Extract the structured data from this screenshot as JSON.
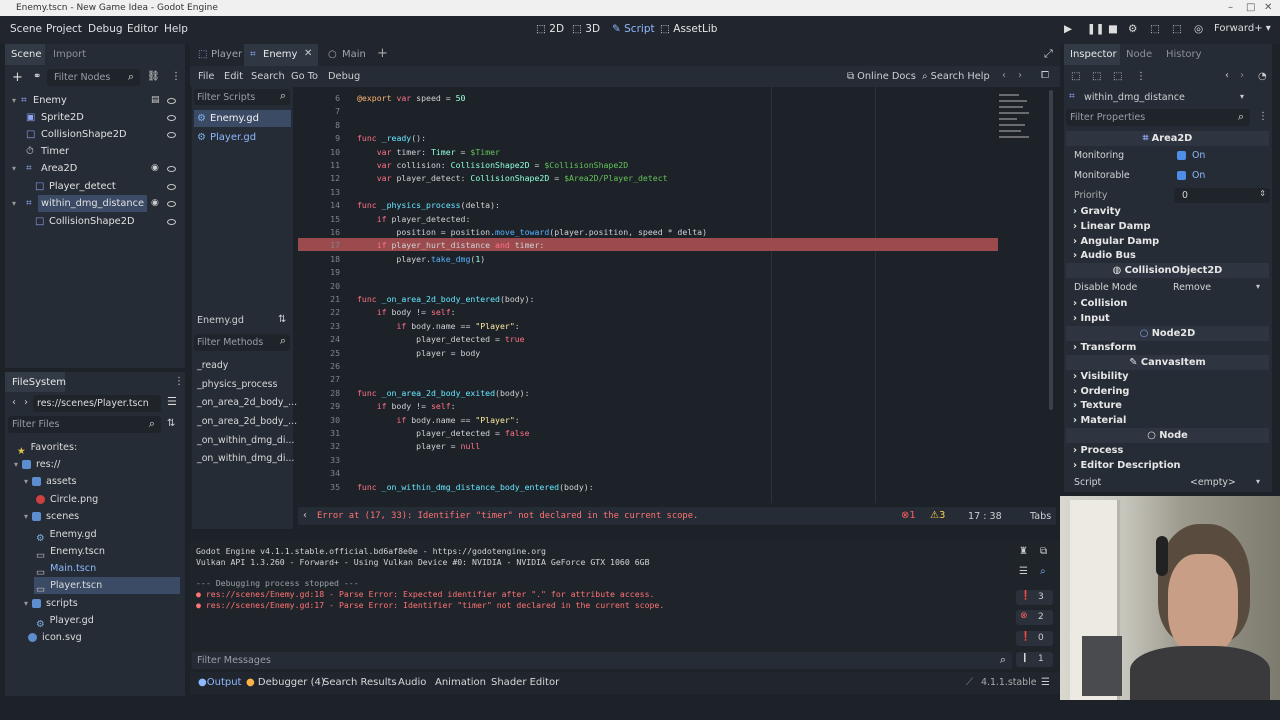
{
  "window": {
    "title": "Enemy.tscn - New Game Idea - Godot Engine"
  },
  "menu": {
    "items": [
      "Scene",
      "Project",
      "Debug",
      "Editor",
      "Help"
    ]
  },
  "main_tabs": [
    "2D",
    "3D",
    "Script",
    "AssetLib"
  ],
  "renderer": "Forward+",
  "scene_dock": {
    "tabs": [
      "Scene",
      "Import"
    ],
    "filter_placeholder": "Filter Nodes",
    "nodes": [
      "Enemy",
      "Sprite2D",
      "CollisionShape2D",
      "Timer",
      "Area2D",
      "Player_detect",
      "within_dmg_distance",
      "CollisionShape2D"
    ]
  },
  "filesystem": {
    "title": "FileSystem",
    "path": "res://scenes/Player.tscn",
    "filter_placeholder": "Filter Files",
    "items": [
      "Favorites:",
      "res://",
      "assets",
      "Circle.png",
      "scenes",
      "Enemy.gd",
      "Enemy.tscn",
      "Main.tscn",
      "Player.tscn",
      "scripts",
      "Player.gd",
      "icon.svg"
    ]
  },
  "editor_tabs": [
    "Player",
    "Enemy",
    "Main"
  ],
  "script_menu": [
    "File",
    "Edit",
    "Search",
    "Go To",
    "Debug"
  ],
  "online_docs": "Online Docs",
  "search_help": "Search Help",
  "scripts_list": {
    "filter_placeholder": "Filter Scripts",
    "items": [
      "Enemy.gd",
      "Player.gd"
    ]
  },
  "methods": {
    "current": "Enemy.gd",
    "filter_placeholder": "Filter Methods",
    "items": [
      "_ready",
      "_physics_process",
      "_on_area_2d_body_...",
      "_on_area_2d_body_...",
      "_on_within_dmg_di...",
      "_on_within_dmg_di..."
    ]
  },
  "code_lines": [
    {
      "n": "6",
      "t": "@export var speed = 50"
    },
    {
      "n": "7",
      "t": ""
    },
    {
      "n": "8",
      "t": ""
    },
    {
      "n": "9",
      "t": "func _ready():"
    },
    {
      "n": "10",
      "t": "    var timer: Timer = $Timer"
    },
    {
      "n": "11",
      "t": "    var collision: CollisionShape2D = $CollisionShape2D"
    },
    {
      "n": "12",
      "t": "    var player_detect: CollisionShape2D = $Area2D/Player_detect"
    },
    {
      "n": "13",
      "t": ""
    },
    {
      "n": "14",
      "t": "func _physics_process(delta):"
    },
    {
      "n": "15",
      "t": "    if player_detected:"
    },
    {
      "n": "16",
      "t": "        position = position.move_toward(player.position, speed * delta)"
    },
    {
      "n": "17",
      "t": "    if player_hurt_distance and timer:"
    },
    {
      "n": "18",
      "t": "        player.take_dmg(1)"
    },
    {
      "n": "19",
      "t": ""
    },
    {
      "n": "20",
      "t": ""
    },
    {
      "n": "21",
      "t": "func _on_area_2d_body_entered(body):"
    },
    {
      "n": "22",
      "t": "    if body != self:"
    },
    {
      "n": "23",
      "t": "        if body.name == \"Player\":"
    },
    {
      "n": "24",
      "t": "            player_detected = true"
    },
    {
      "n": "25",
      "t": "            player = body"
    },
    {
      "n": "26",
      "t": ""
    },
    {
      "n": "27",
      "t": ""
    },
    {
      "n": "28",
      "t": "func _on_area_2d_body_exited(body):"
    },
    {
      "n": "29",
      "t": "    if body != self:"
    },
    {
      "n": "30",
      "t": "        if body.name == \"Player\":"
    },
    {
      "n": "31",
      "t": "            player_detected = false"
    },
    {
      "n": "32",
      "t": "            player = null"
    },
    {
      "n": "33",
      "t": ""
    },
    {
      "n": "34",
      "t": ""
    },
    {
      "n": "35",
      "t": "func _on_within_dmg_distance_body_entered(body):"
    }
  ],
  "status": {
    "error": "Error at (17, 33): Identifier \"timer\" not declared in the current scope.",
    "errors": "1",
    "warnings": "3",
    "cursor": "17 :  38",
    "indent": "Tabs"
  },
  "output": {
    "lines": [
      "Godot Engine v4.1.1.stable.official.bd6af8e0e - https://godotengine.org",
      "Vulkan API 1.3.260 - Forward+ - Using Vulkan Device #0: NVIDIA - NVIDIA GeForce GTX 1060 6GB",
      "",
      "--- Debugging process stopped ---"
    ],
    "errors": [
      "res://scenes/Enemy.gd:18 - Parse Error: Expected identifier after \".\" for attribute access.",
      "res://scenes/Enemy.gd:17 - Parse Error: Identifier \"timer\" not declared in the current scope."
    ],
    "filter_placeholder": "Filter Messages",
    "counts": [
      "3",
      "2",
      "0",
      "1"
    ]
  },
  "bottom_tabs": [
    "Output",
    "Debugger (4)",
    "Search Results",
    "Audio",
    "Animation",
    "Shader Editor"
  ],
  "version": "4.1.1.stable",
  "inspector": {
    "tabs": [
      "Inspector",
      "Node",
      "History"
    ],
    "object": "within_dmg_distance",
    "filter_placeholder": "Filter Properties",
    "class_area": "Area2D",
    "monitoring_label": "Monitoring",
    "monitoring_value": "On",
    "monitorable_label": "Monitorable",
    "monitorable_value": "On",
    "priority_label": "Priority",
    "priority_value": "0",
    "sections_a": [
      "Gravity",
      "Linear Damp",
      "Angular Damp",
      "Audio Bus"
    ],
    "class_collision": "CollisionObject2D",
    "disable_mode_label": "Disable Mode",
    "disable_mode_value": "Remove",
    "sections_b": [
      "Collision",
      "Input"
    ],
    "class_node2d": "Node2D",
    "sections_c": [
      "Transform"
    ],
    "class_canvas": "CanvasItem",
    "sections_d": [
      "Visibility",
      "Ordering",
      "Texture",
      "Material"
    ],
    "class_node": "Node",
    "sections_e": [
      "Process",
      "Editor Description"
    ],
    "script_label": "Script",
    "script_value": "<empty>"
  }
}
